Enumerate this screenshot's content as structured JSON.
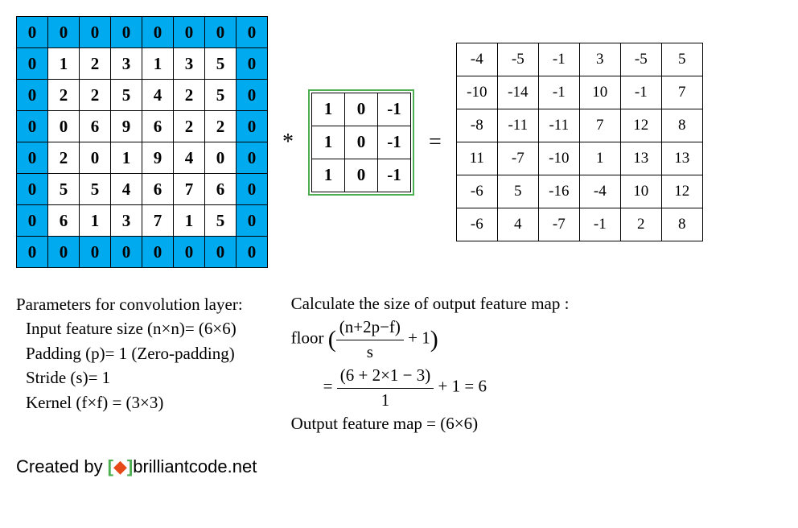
{
  "input_matrix": [
    [
      0,
      0,
      0,
      0,
      0,
      0,
      0,
      0
    ],
    [
      0,
      1,
      2,
      3,
      1,
      3,
      5,
      0
    ],
    [
      0,
      2,
      2,
      5,
      4,
      2,
      5,
      0
    ],
    [
      0,
      0,
      6,
      9,
      6,
      2,
      2,
      0
    ],
    [
      0,
      2,
      0,
      1,
      9,
      4,
      0,
      0
    ],
    [
      0,
      5,
      5,
      4,
      6,
      7,
      6,
      0
    ],
    [
      0,
      6,
      1,
      3,
      7,
      1,
      5,
      0
    ],
    [
      0,
      0,
      0,
      0,
      0,
      0,
      0,
      0
    ]
  ],
  "kernel": [
    [
      1,
      0,
      -1
    ],
    [
      1,
      0,
      -1
    ],
    [
      1,
      0,
      -1
    ]
  ],
  "output_matrix": [
    [
      -4,
      -5,
      -1,
      3,
      -5,
      5
    ],
    [
      -10,
      -14,
      -1,
      10,
      -1,
      7
    ],
    [
      -8,
      -11,
      -11,
      7,
      12,
      8
    ],
    [
      11,
      -7,
      -10,
      1,
      13,
      13
    ],
    [
      -6,
      5,
      -16,
      -4,
      10,
      12
    ],
    [
      -6,
      4,
      -7,
      -1,
      2,
      8
    ]
  ],
  "op_conv": "*",
  "op_eq": "=",
  "params": {
    "title": "Parameters for convolution layer:",
    "input": "Input feature size (n×n)= (6×6)",
    "padding": "Padding (p)= 1 (Zero-padding)",
    "stride": "Stride (s)= 1",
    "kernel": "Kernel (f×f) = (3×3)"
  },
  "calc": {
    "title": "Calculate the size of output feature map :",
    "floor": "floor",
    "formula_num": "(n+2p−f)",
    "formula_den": "s",
    "plus1": "+ 1",
    "eq": "=",
    "val_num": "(6 + 2×1 − 3)",
    "val_den": "1",
    "result": "+ 1 = 6",
    "output": "Output feature map = (6×6)"
  },
  "created": {
    "prefix": "Created by",
    "site": "brilliantcode.net"
  }
}
